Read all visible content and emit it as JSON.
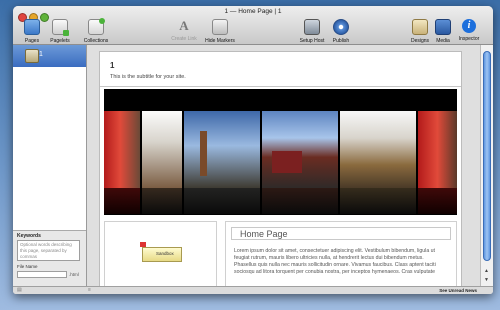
{
  "window": {
    "title": "1 — Home Page | 1"
  },
  "toolbar": {
    "pages": "Pages",
    "pagelets": "Pagelets",
    "collections": "Collections",
    "create_link": "Create Link",
    "hide_markers": "Hide Markers",
    "setup_host": "Setup Host",
    "publish": "Publish",
    "designs": "Designs",
    "media": "Media",
    "inspector": "Inspector"
  },
  "sidebar": {
    "selected_item": "1",
    "keywords_label": "Keywords",
    "keywords_placeholder": "Optional words describing this page, separated by commas",
    "filename_label": "File Name",
    "filename_ext": ".html"
  },
  "site": {
    "title": "1",
    "subtitle": "This is the subtitle for your site.",
    "badge": "Sandbox",
    "page_heading": "Home Page",
    "body_text": "Lorem ipsum dolor sit amet, consectetuer adipiscing elit. Vestibulum bibendum, ligula ut feugiat rutrum, mauris libero ultricies nulla, at hendrerit lectus dui bibendum metus. Phasellus quis nulla nec mauris sollicitudin ornare. Vivamus faucibus. Class aptent taciti sociosqu ad litora torquent per conubia nostra, per inceptos hymenaeos. Cras vulputate"
  },
  "status": {
    "link": "See Unread News"
  },
  "colors": {
    "accent": "#3a6cc0",
    "info": "#1d6fdc",
    "banner_bg": "#000000"
  }
}
